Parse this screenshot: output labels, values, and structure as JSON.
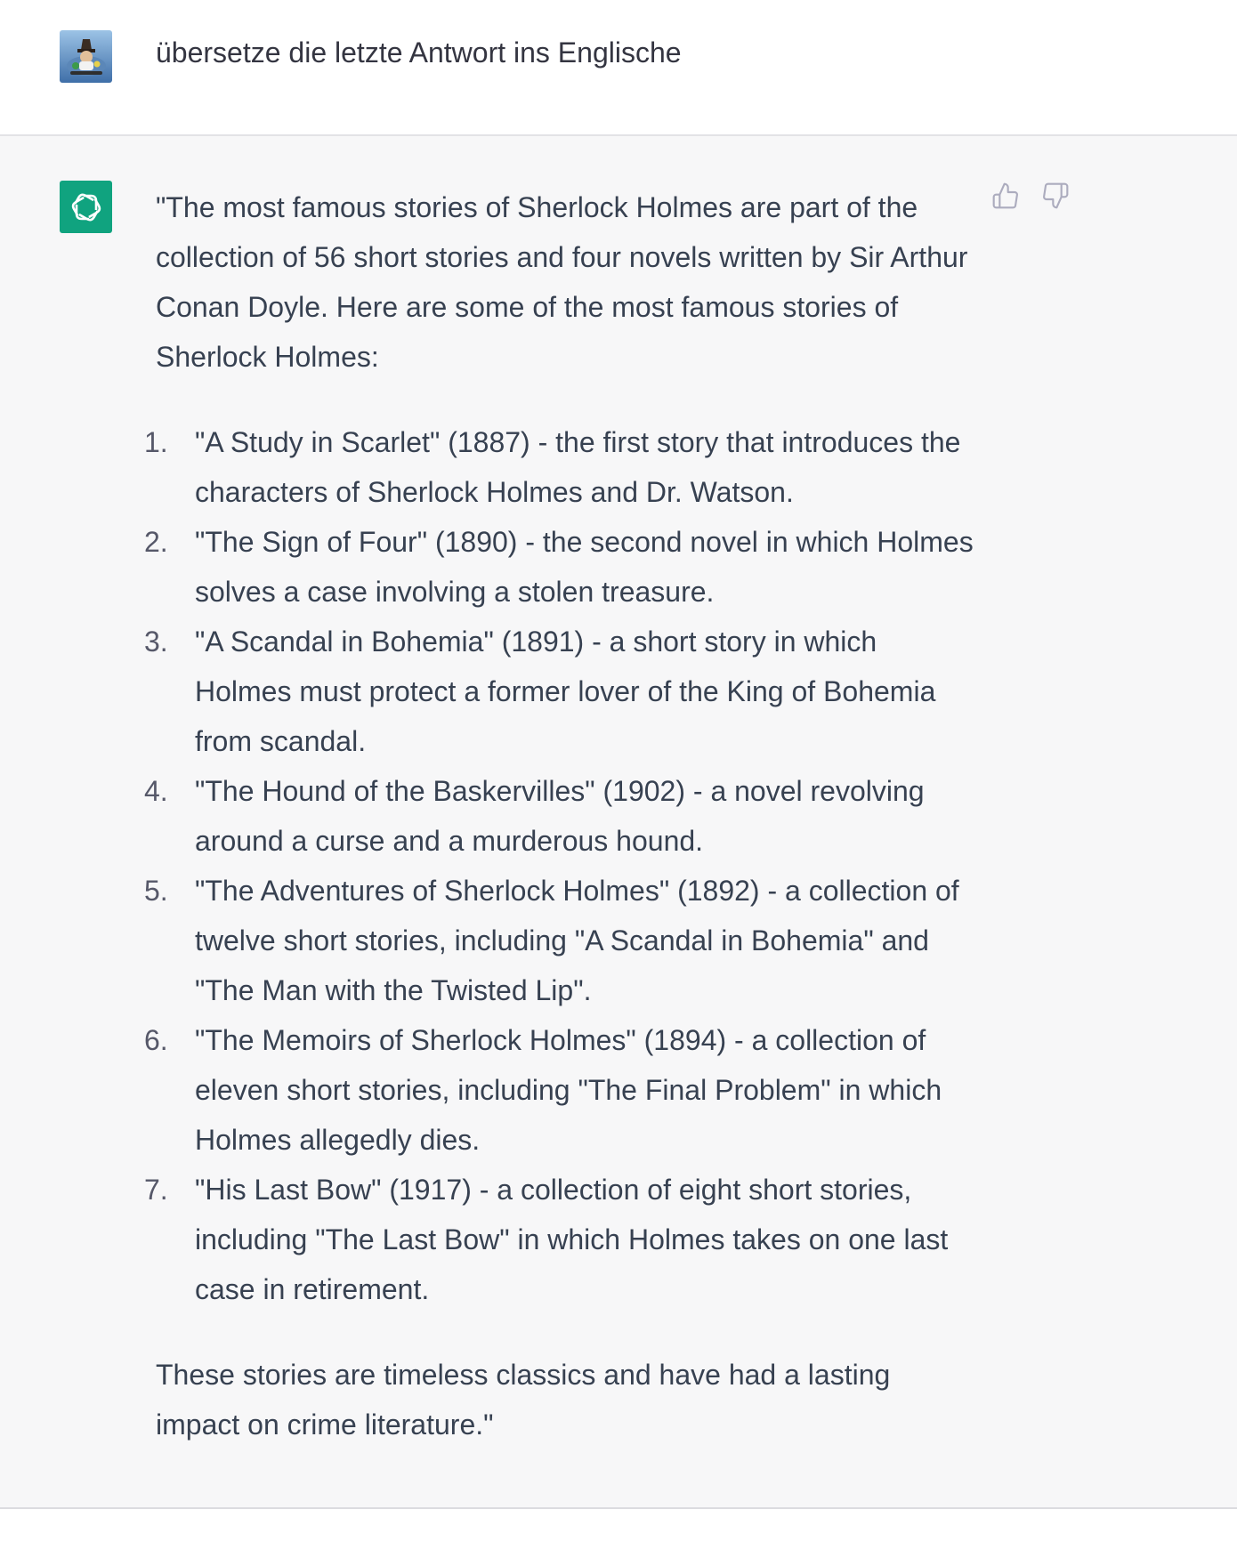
{
  "conversation": {
    "user_message": {
      "text": "übersetze die letzte Antwort ins Englische",
      "avatar_icon": "user-avatar-icon"
    },
    "assistant_message": {
      "avatar_icon": "openai-logo-icon",
      "avatar_color": "#10a37f",
      "intro": "\"The most famous stories of Sherlock Holmes are part of the collection of 56 short stories and four novels written by Sir Arthur Conan Doyle. Here are some of the most famous stories of Sherlock Holmes:",
      "list": [
        {
          "number": "1.",
          "text": "\"A Study in Scarlet\" (1887) - the first story that introduces the characters of Sherlock Holmes and Dr. Watson."
        },
        {
          "number": "2.",
          "text": "\"The Sign of Four\" (1890) - the second novel in which Holmes solves a case involving a stolen treasure."
        },
        {
          "number": "3.",
          "text": "\"A Scandal in Bohemia\" (1891) - a short story in which Holmes must protect a former lover of the King of Bohemia from scandal."
        },
        {
          "number": "4.",
          "text": "\"The Hound of the Baskervilles\" (1902) - a novel revolving around a curse and a murderous hound."
        },
        {
          "number": "5.",
          "text": "\"The Adventures of Sherlock Holmes\" (1892) - a collection of twelve short stories, including \"A Scandal in Bohemia\" and \"The Man with the Twisted Lip\"."
        },
        {
          "number": "6.",
          "text": "\"The Memoirs of Sherlock Holmes\" (1894) - a collection of eleven short stories, including \"The Final Problem\" in which Holmes allegedly dies."
        },
        {
          "number": "7.",
          "text": "\"His Last Bow\" (1917) - a collection of eight short stories, including \"The Last Bow\" in which Holmes takes on one last case in retirement."
        }
      ],
      "closing": "These stories are timeless classics and have had a lasting impact on crime literature.\"",
      "feedback": {
        "thumbs_up_icon": "thumbs-up-icon",
        "thumbs_down_icon": "thumbs-down-icon"
      }
    }
  }
}
